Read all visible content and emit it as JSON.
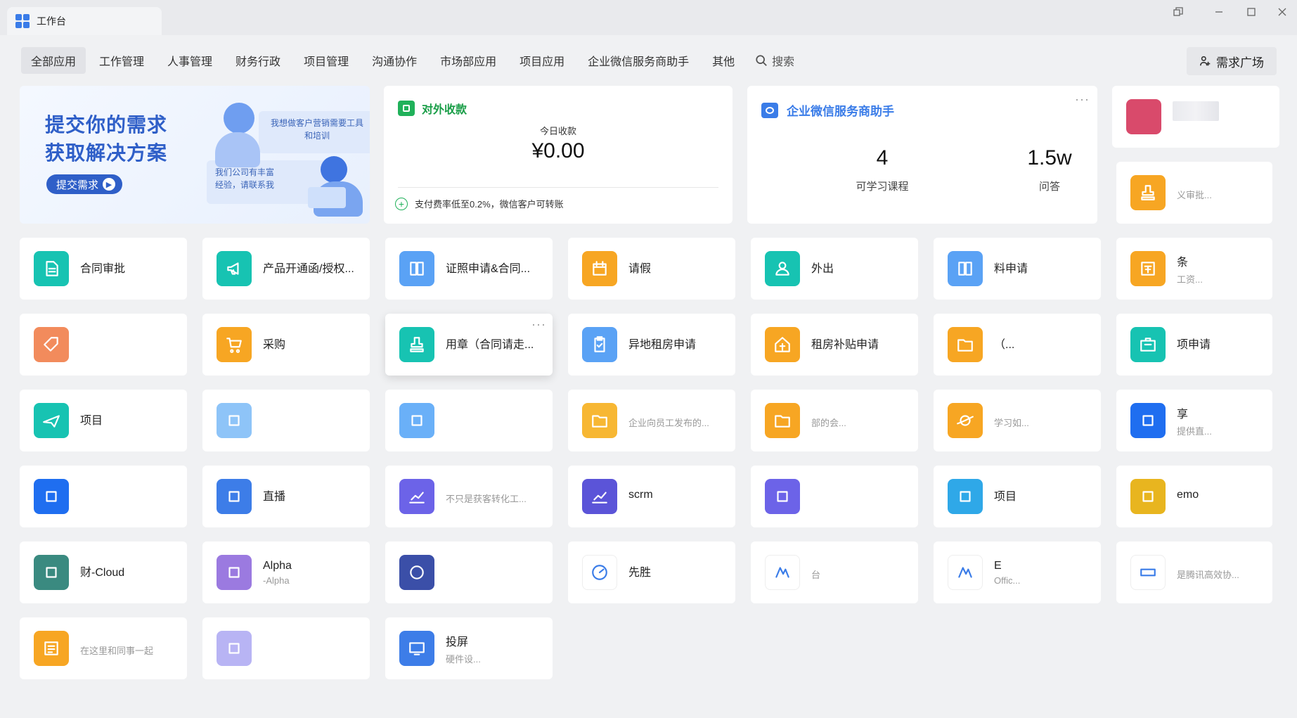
{
  "window": {
    "tab_title": "工作台"
  },
  "nav": {
    "items": [
      "全部应用",
      "工作管理",
      "人事管理",
      "财务行政",
      "项目管理",
      "沟通协作",
      "市场部应用",
      "项目应用",
      "企业微信服务商助手",
      "其他"
    ],
    "search_label": "搜索",
    "demand_button": "需求广场"
  },
  "banner": {
    "title_line1": "提交你的需求",
    "title_line2": "获取解决方案",
    "submit_label": "提交需求",
    "bubble1": "我想做客户营销需要工具和培训",
    "bubble2": "我们公司有丰富经验，请联系我"
  },
  "payment": {
    "title": "对外收款",
    "today_label": "今日收款",
    "amount": "¥0.00",
    "footer": "支付费率低至0.2%，微信客户可转账"
  },
  "wecom": {
    "title": "企业微信服务商助手",
    "courses_value": "4",
    "courses_label": "可学习课程",
    "qa_value": "1.5w",
    "qa_label": "问答"
  },
  "colors": {
    "teal": "#17c3b2",
    "blue": "#5aa2f5",
    "orange": "#f7a623",
    "purple": "#6c63e8",
    "deep_blue": "#1f6ef0"
  },
  "apps": [
    {
      "name": "",
      "desc": "义审批...",
      "icon": "stamp-icon",
      "color": "#f7a623"
    },
    {
      "name": "合同审批",
      "desc": "",
      "icon": "document-icon",
      "color": "#17c3b2"
    },
    {
      "name": "产品开通函/授权...",
      "desc": "",
      "icon": "megaphone-icon",
      "color": "#17c3b2"
    },
    {
      "name": "证照申请&合同...",
      "desc": "",
      "icon": "binder-icon",
      "color": "#5aa2f5"
    },
    {
      "name": "请假",
      "desc": "",
      "icon": "calendar-icon",
      "color": "#f7a623"
    },
    {
      "name": "外出",
      "desc": "",
      "icon": "person-icon",
      "color": "#17c3b2"
    },
    {
      "name": "料申请",
      "desc": "",
      "icon": "binder-icon",
      "color": "#5aa2f5"
    },
    {
      "name": "条",
      "desc": "工资...",
      "icon": "payslip-icon",
      "color": "#f7a623"
    },
    {
      "name": "",
      "desc": "",
      "icon": "tag-icon",
      "color": "#f28b5c"
    },
    {
      "name": "采购",
      "desc": "",
      "icon": "cart-icon",
      "color": "#f7a623"
    },
    {
      "name": "用章（合同请走...",
      "desc": "",
      "icon": "stamp-icon",
      "color": "#17c3b2"
    },
    {
      "name": "异地租房申请",
      "desc": "",
      "icon": "clipboard-icon",
      "color": "#5aa2f5"
    },
    {
      "name": "租房补贴申请",
      "desc": "",
      "icon": "house-icon",
      "color": "#f7a623"
    },
    {
      "name": "（...",
      "desc": "",
      "icon": "folder-icon",
      "color": "#f7a623"
    },
    {
      "name": "项申请",
      "desc": "",
      "icon": "briefcase-icon",
      "color": "#17c3b2"
    },
    {
      "name": "项目",
      "desc": "",
      "icon": "plane-icon",
      "color": "#17c3b2"
    },
    {
      "name": "",
      "desc": "",
      "icon": "app-icon",
      "color": "#8ec4f8"
    },
    {
      "name": "",
      "desc": "",
      "icon": "app-icon",
      "color": "#6ab0f8"
    },
    {
      "name": "",
      "desc": "企业向员工发布的...",
      "icon": "folder-icon",
      "color": "#f7b733"
    },
    {
      "name": "",
      "desc": "部的会...",
      "icon": "folder-icon",
      "color": "#f7a623"
    },
    {
      "name": "",
      "desc": "学习如...",
      "icon": "planet-icon",
      "color": "#f7a623"
    },
    {
      "name": "享",
      "desc": "提供直...",
      "icon": "app-icon",
      "color": "#1f6ef0"
    },
    {
      "name": "",
      "desc": "",
      "icon": "app-icon",
      "color": "#1f6ef0"
    },
    {
      "name": "直播",
      "desc": "",
      "icon": "app-icon",
      "color": "#3d7de8"
    },
    {
      "name": "",
      "desc": "不只是获客转化工...",
      "icon": "chart-icon",
      "color": "#6c63e8"
    },
    {
      "name": "scrm",
      "desc": "",
      "icon": "chart-icon",
      "color": "#5b54d8"
    },
    {
      "name": "",
      "desc": "",
      "icon": "app-icon",
      "color": "#6c63e8"
    },
    {
      "name": "项目",
      "desc": "",
      "icon": "app-icon",
      "color": "#2fa8e8"
    },
    {
      "name": "emo",
      "desc": "",
      "icon": "app-icon",
      "color": "#e8b51f"
    },
    {
      "name": "财-Cloud",
      "desc": "",
      "icon": "app-icon",
      "color": "#3a8a80"
    },
    {
      "name": "Alpha",
      "desc": "-Alpha",
      "icon": "app-icon",
      "color": "#9b7ae0"
    },
    {
      "name": "",
      "desc": "",
      "icon": "pikachu-icon",
      "color": "#3b4fa8"
    },
    {
      "name": "先胜",
      "desc": "",
      "icon": "gauge-icon",
      "color": "#ffffff"
    },
    {
      "name": "",
      "desc": "台",
      "icon": "logo-icon",
      "color": "#ffffff"
    },
    {
      "name": "E",
      "desc": "Offic...",
      "icon": "logo-icon",
      "color": "#ffffff"
    },
    {
      "name": "",
      "desc": "是腾讯高效协...",
      "icon": "tapd-icon",
      "color": "#ffffff"
    },
    {
      "name": "",
      "desc": "在这里和同事一起",
      "icon": "note-icon",
      "color": "#f7a623"
    },
    {
      "name": "",
      "desc": "",
      "icon": "app-icon",
      "color": "#b8b4f4"
    },
    {
      "name": "投屏",
      "desc": "硬件设...",
      "icon": "screen-icon",
      "color": "#3d7de8"
    }
  ]
}
